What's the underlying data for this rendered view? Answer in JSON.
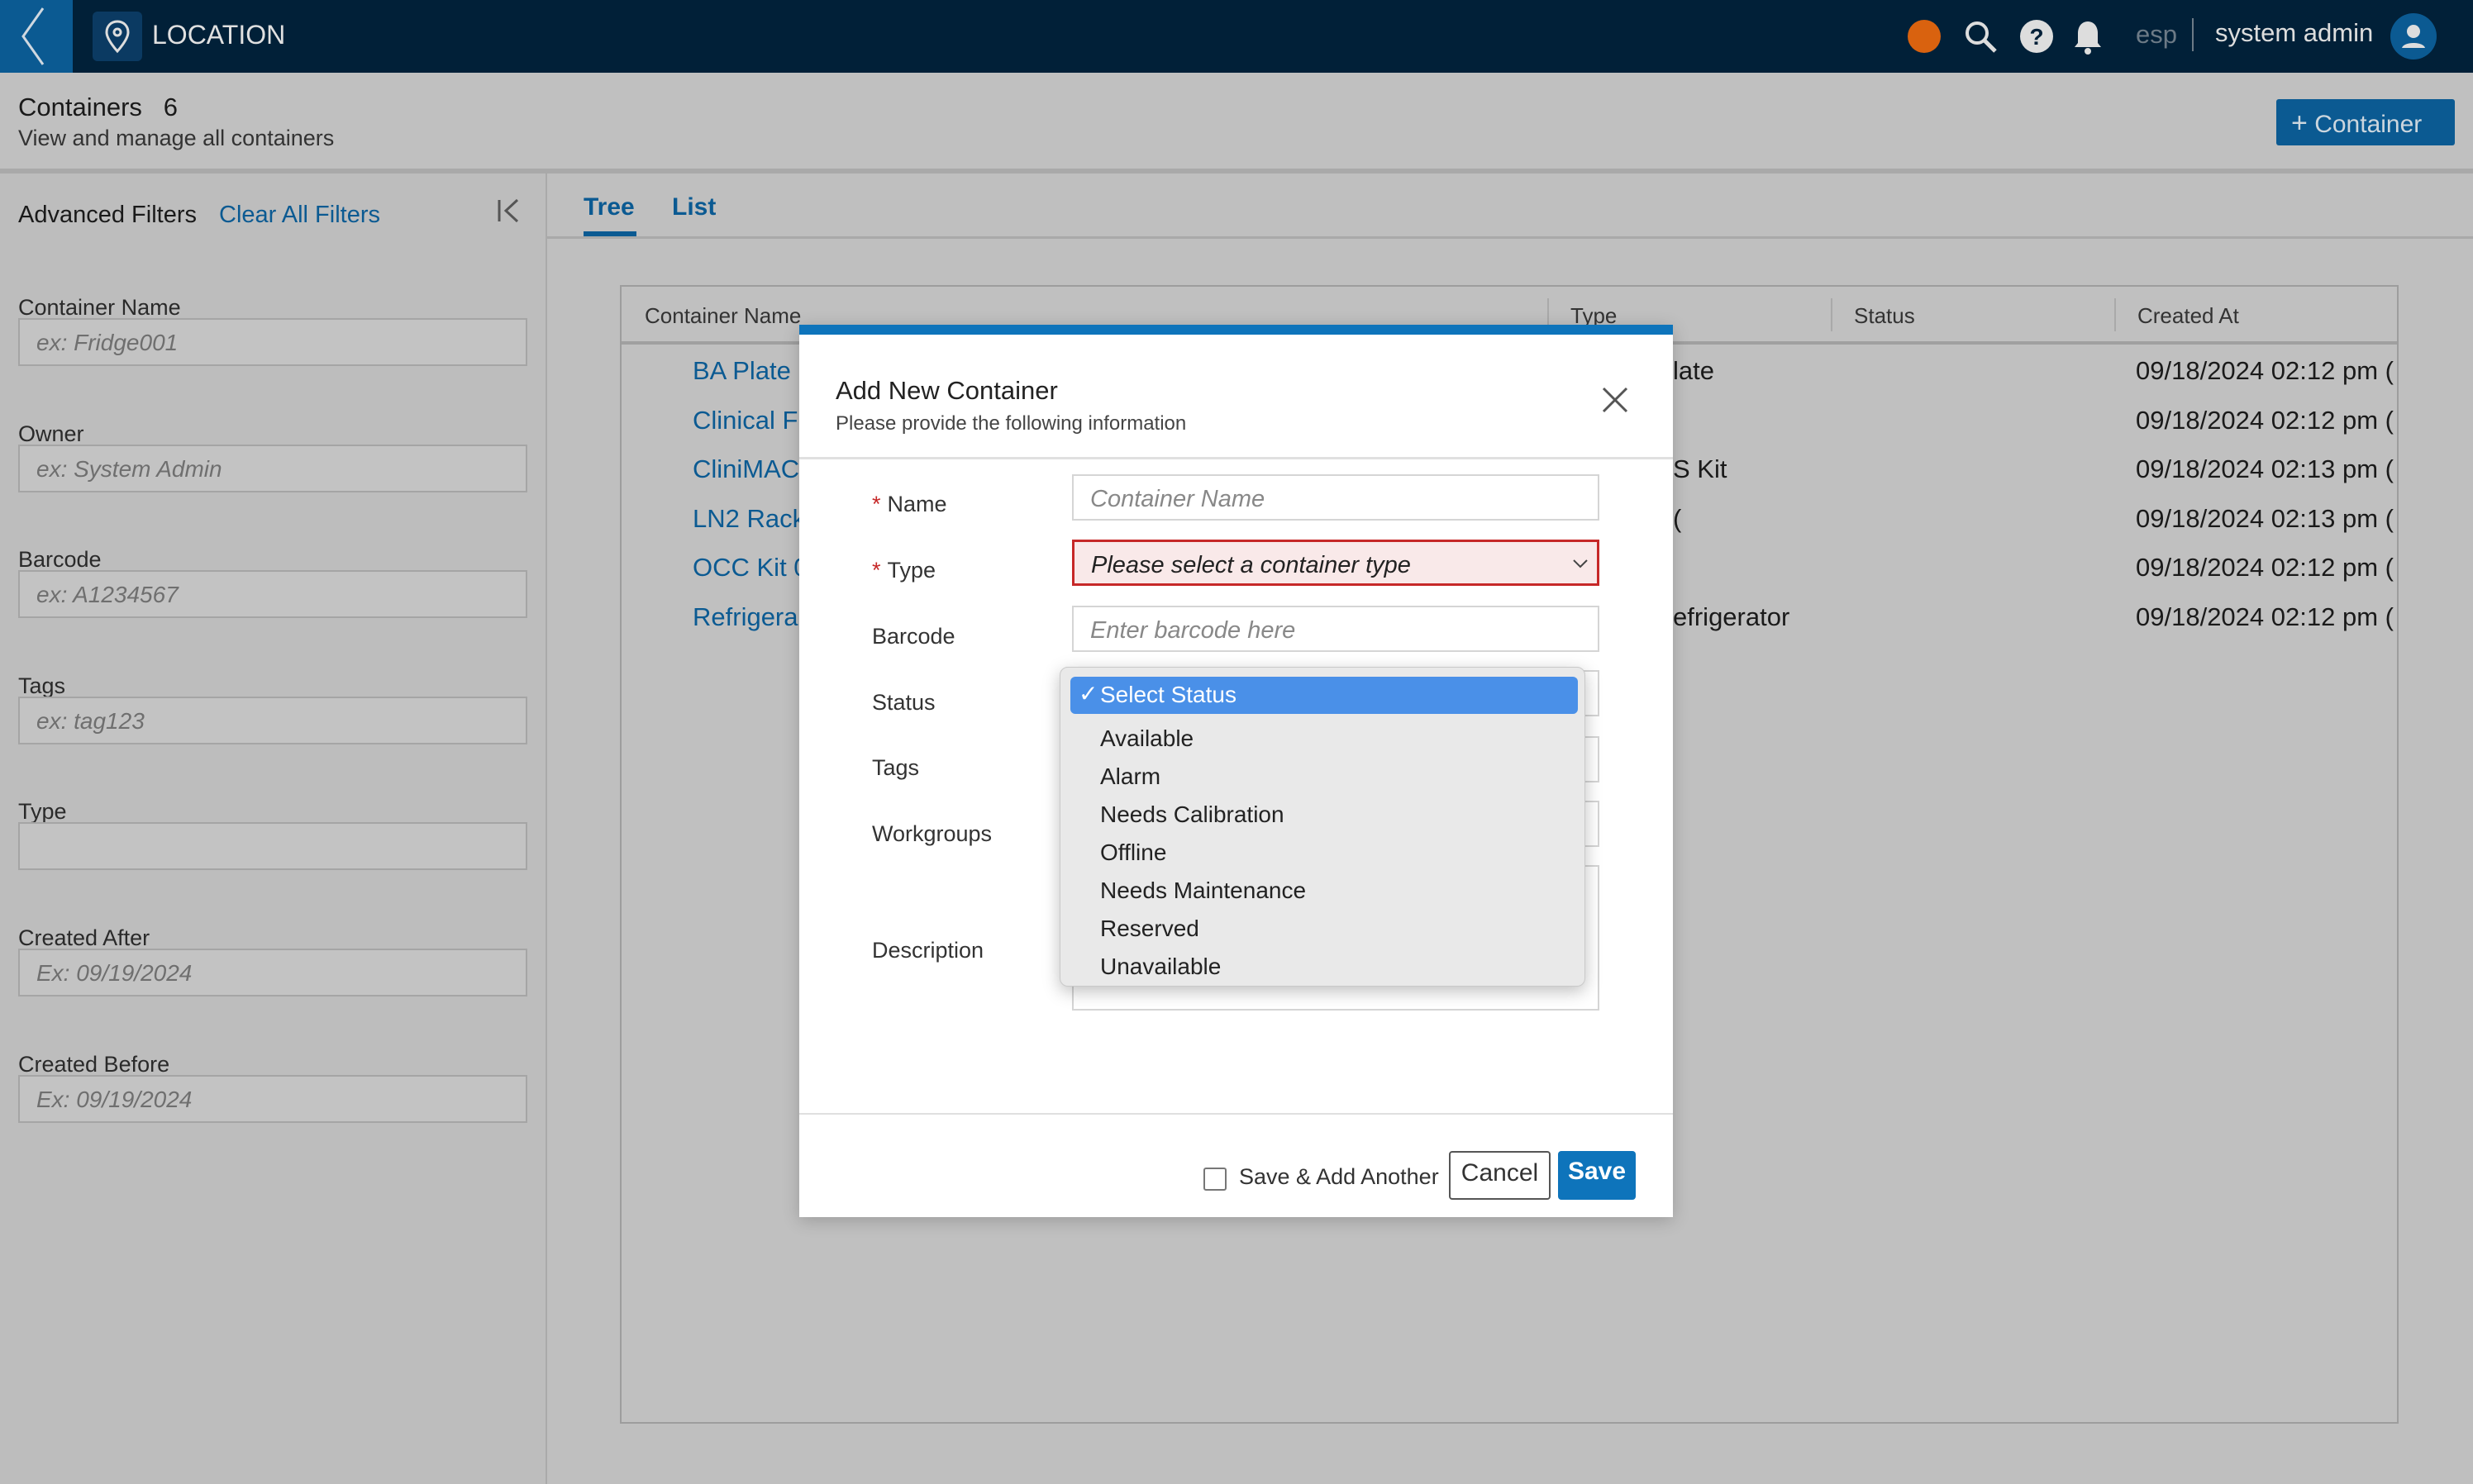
{
  "header": {
    "title": "LOCATION",
    "lang": "esp",
    "user": "system admin",
    "icons": [
      "back-chevron-icon",
      "location-pin-icon",
      "status-dot-icon",
      "search-icon",
      "help-icon",
      "bell-icon",
      "user-avatar-icon"
    ],
    "status_color": "#d9620f"
  },
  "page": {
    "title": "Containers",
    "count": "6",
    "subtitle": "View and manage all containers",
    "add_button": "Container"
  },
  "filters": {
    "title": "Advanced Filters",
    "clear": "Clear All Filters",
    "fields": [
      {
        "label": "Container Name",
        "placeholder": "ex: Fridge001"
      },
      {
        "label": "Owner",
        "placeholder": "ex: System Admin"
      },
      {
        "label": "Barcode",
        "placeholder": "ex: A1234567"
      },
      {
        "label": "Tags",
        "placeholder": "ex: tag123"
      },
      {
        "label": "Type",
        "placeholder": ""
      },
      {
        "label": "Created After",
        "placeholder": "Ex: 09/19/2024"
      },
      {
        "label": "Created Before",
        "placeholder": "Ex: 09/19/2024"
      }
    ]
  },
  "tabs": [
    {
      "label": "Tree",
      "active": true
    },
    {
      "label": "List",
      "active": false
    }
  ],
  "table": {
    "columns": [
      "Container Name",
      "Type",
      "Status",
      "Created At"
    ],
    "rows": [
      {
        "name": "BA Plate (",
        "type": "late",
        "created": "09/18/2024 02:12 pm ("
      },
      {
        "name": "Clinical Fr",
        "type": "",
        "created": "09/18/2024 02:12 pm ("
      },
      {
        "name": "CliniMAC",
        "type": "S Kit",
        "created": "09/18/2024 02:13 pm ("
      },
      {
        "name": "LN2 Rack",
        "type": "(",
        "created": "09/18/2024 02:13 pm ("
      },
      {
        "name": "OCC Kit 0",
        "type": "",
        "created": "09/18/2024 02:12 pm ("
      },
      {
        "name": "Refrigera",
        "type": "efrigerator",
        "created": "09/18/2024 02:12 pm ("
      }
    ]
  },
  "modal": {
    "title": "Add New Container",
    "subtitle": "Please provide the following information",
    "name_label": "Name",
    "name_placeholder": "Container Name",
    "type_label": "Type",
    "type_placeholder": "Please select a container type",
    "barcode_label": "Barcode",
    "barcode_placeholder": "Enter barcode here",
    "status_label": "Status",
    "tags_label": "Tags",
    "workgroups_label": "Workgroups",
    "description_label": "Description",
    "save_another": "Save & Add Another",
    "cancel": "Cancel",
    "save": "Save"
  },
  "status_dropdown": {
    "selected": "Select Status",
    "options": [
      "Available",
      "Alarm",
      "Needs Calibration",
      "Offline",
      "Needs Maintenance",
      "Reserved",
      "Unavailable"
    ]
  }
}
